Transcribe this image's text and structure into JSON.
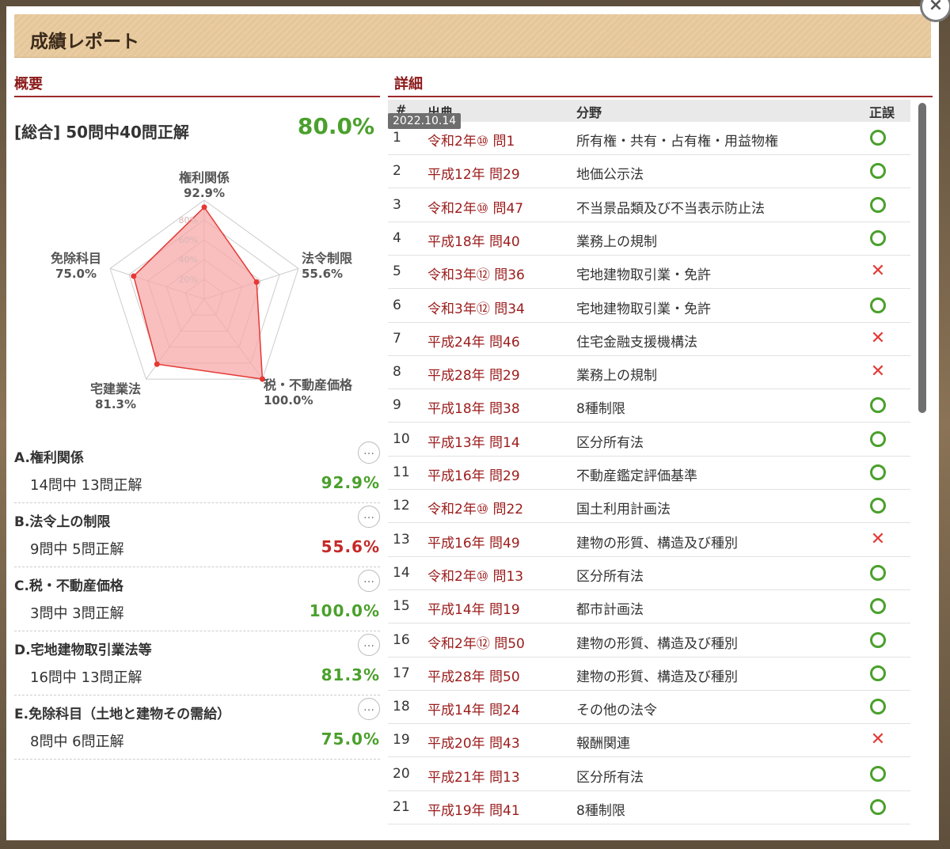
{
  "report": {
    "title": "成績レポート",
    "close_label": "×"
  },
  "overview": {
    "title": "概要",
    "total_label": "[総合] 50問中40問正解",
    "total_pct": "80.0%"
  },
  "radar": {
    "axes": [
      {
        "label": "権利関係",
        "value_label": "92.9%",
        "value": 92.9
      },
      {
        "label": "法令制限",
        "value_label": "55.6%",
        "value": 55.6
      },
      {
        "label": "税・不動産価格",
        "value_label": "100.0%",
        "value": 100.0
      },
      {
        "label": "宅建業法",
        "value_label": "81.3%",
        "value": 81.3
      },
      {
        "label": "免除科目",
        "value_label": "75.0%",
        "value": 75.0
      }
    ],
    "ticks": [
      "20%",
      "40%",
      "60%",
      "80%"
    ],
    "fill_color": "#f7a8a8",
    "stroke_color": "#e53935"
  },
  "categories": [
    {
      "title": "A.権利関係",
      "count": "14問中 13問正解",
      "pct": "92.9%",
      "color": "#4aa02c"
    },
    {
      "title": "B.法令上の制限",
      "count": "9問中 5問正解",
      "pct": "55.6%",
      "color": "#c62828"
    },
    {
      "title": "C.税・不動産価格",
      "count": "3問中 3問正解",
      "pct": "100.0%",
      "color": "#4aa02c"
    },
    {
      "title": "D.宅地建物取引業法等",
      "count": "16問中 13問正解",
      "pct": "81.3%",
      "color": "#4aa02c"
    },
    {
      "title": "E.免除科目（土地と建物その需給）",
      "count": "8問中 6問正解",
      "pct": "75.0%",
      "color": "#4aa02c"
    }
  ],
  "more_label": "…",
  "detail": {
    "title": "詳細",
    "headers": {
      "num": "#",
      "source": "出典",
      "field": "分野",
      "result": "正誤"
    },
    "tooltip": "2022.10.14",
    "rows": [
      {
        "num": "1",
        "source": "令和2年⑩ 問1",
        "field": "所有権・共有・占有権・用益物権",
        "result": "ok"
      },
      {
        "num": "2",
        "source": "平成12年 問29",
        "field": "地価公示法",
        "result": "ok"
      },
      {
        "num": "3",
        "source": "令和2年⑩ 問47",
        "field": "不当景品類及び不当表示防止法",
        "result": "ok"
      },
      {
        "num": "4",
        "source": "平成18年 問40",
        "field": "業務上の規制",
        "result": "ok"
      },
      {
        "num": "5",
        "source": "令和3年⑫ 問36",
        "field": "宅地建物取引業・免許",
        "result": "ng"
      },
      {
        "num": "6",
        "source": "令和3年⑫ 問34",
        "field": "宅地建物取引業・免許",
        "result": "ok"
      },
      {
        "num": "7",
        "source": "平成24年 問46",
        "field": "住宅金融支援機構法",
        "result": "ng"
      },
      {
        "num": "8",
        "source": "平成28年 問29",
        "field": "業務上の規制",
        "result": "ng"
      },
      {
        "num": "9",
        "source": "平成18年 問38",
        "field": "8種制限",
        "result": "ok"
      },
      {
        "num": "10",
        "source": "平成13年 問14",
        "field": "区分所有法",
        "result": "ok"
      },
      {
        "num": "11",
        "source": "平成16年 問29",
        "field": "不動産鑑定評価基準",
        "result": "ok"
      },
      {
        "num": "12",
        "source": "令和2年⑩ 問22",
        "field": "国土利用計画法",
        "result": "ok"
      },
      {
        "num": "13",
        "source": "平成16年 問49",
        "field": "建物の形質、構造及び種別",
        "result": "ng"
      },
      {
        "num": "14",
        "source": "令和2年⑩ 問13",
        "field": "区分所有法",
        "result": "ok"
      },
      {
        "num": "15",
        "source": "平成14年 問19",
        "field": "都市計画法",
        "result": "ok"
      },
      {
        "num": "16",
        "source": "令和2年⑫ 問50",
        "field": "建物の形質、構造及び種別",
        "result": "ok"
      },
      {
        "num": "17",
        "source": "平成28年 問50",
        "field": "建物の形質、構造及び種別",
        "result": "ok"
      },
      {
        "num": "18",
        "source": "平成14年 問24",
        "field": "その他の法令",
        "result": "ok"
      },
      {
        "num": "19",
        "source": "平成20年 問43",
        "field": "報酬関連",
        "result": "ng"
      },
      {
        "num": "20",
        "source": "平成21年 問13",
        "field": "区分所有法",
        "result": "ok"
      },
      {
        "num": "21",
        "source": "平成19年 問41",
        "field": "8種制限",
        "result": "ok"
      }
    ]
  }
}
